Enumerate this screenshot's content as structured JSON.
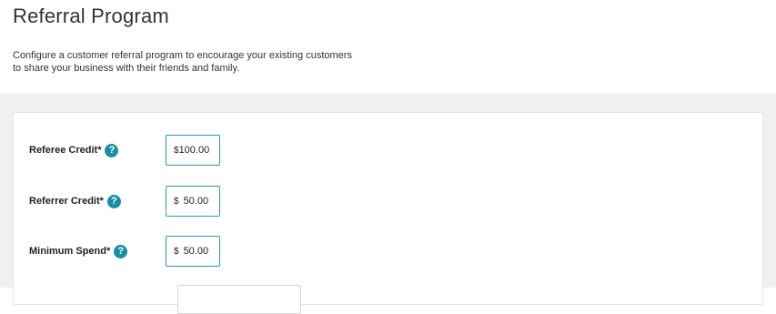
{
  "header": {
    "title": "Referral Program",
    "description_lines": [
      "Configure a customer referral program to encourage your existing customers",
      "to share your business with their friends and family."
    ]
  },
  "fields": [
    {
      "label": "Referee Credit*",
      "currency": "$",
      "amount": "100.00",
      "icon": "help-icon"
    },
    {
      "label": "Referrer Credit*",
      "currency": "$",
      "amount": "50.00",
      "icon": "help-icon"
    },
    {
      "label": "Minimum Spend*",
      "currency": "$",
      "amount": "50.00",
      "icon": "help-icon"
    }
  ],
  "help_glyph": "?",
  "colors": {
    "accent": "#1a8fa3",
    "input_border": "#2a9aac",
    "page_bg": "#f0f0f0"
  }
}
